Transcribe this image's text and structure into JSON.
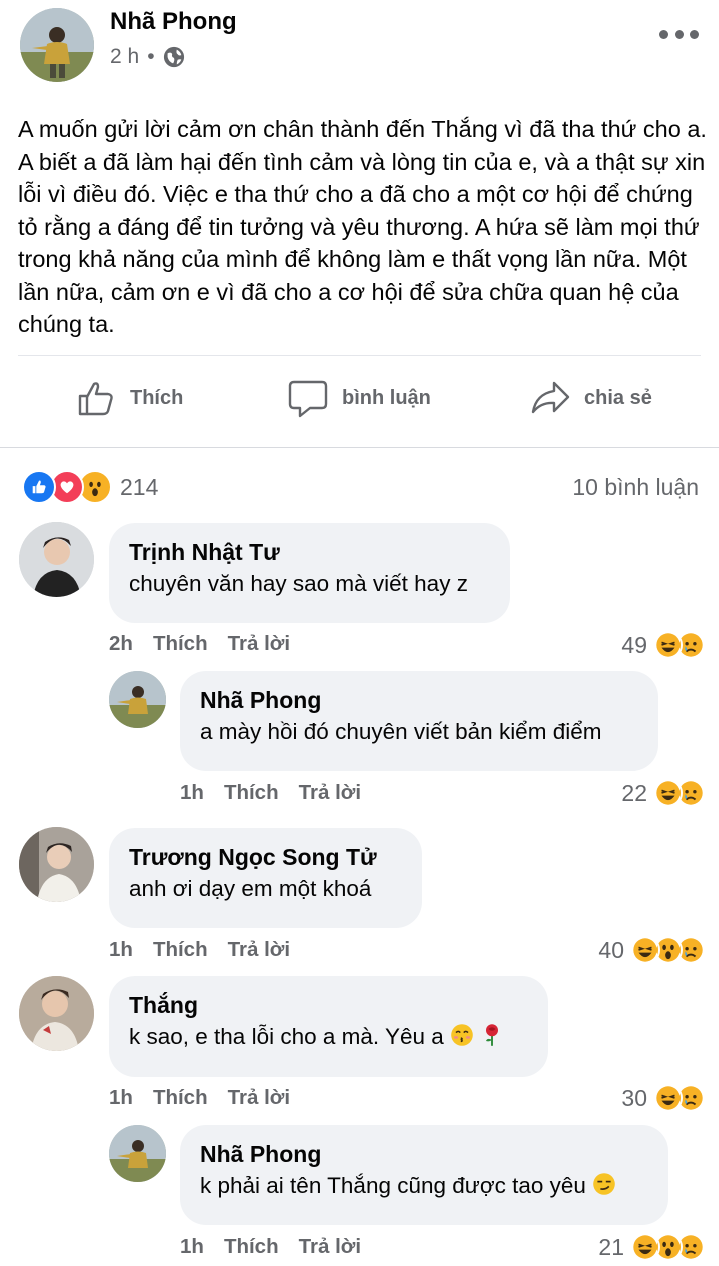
{
  "post": {
    "author": "Nhã Phong",
    "time": "2 h",
    "separator": "•",
    "text": "A muốn gửi lời cảm ơn chân thành đến Thắng vì đã tha thứ cho a. A biết a đã làm hại đến tình cảm và lòng tin của e, và a thật sự xin lỗi vì điều đó. Việc e tha thứ cho a đã cho a một cơ hội để chứng tỏ rằng a đáng để tin tưởng và yêu thương. A hứa sẽ làm mọi thứ trong khả năng của mình để không làm e thất vọng lần nữa. Một lần nữa, cảm ơn e vì đã cho a cơ hội để sửa chữa quan hệ của chúng ta."
  },
  "actions": {
    "like": "Thích",
    "comment": "bình luận",
    "share": "chia sẻ"
  },
  "summary": {
    "reactions": [
      "like",
      "love",
      "wow"
    ],
    "reaction_count": "214",
    "comment_count": "10 bình luận"
  },
  "comments": [
    {
      "name": "Trịnh Nhật Tư",
      "text": "chuyên văn hay sao mà viết hay z",
      "time": "2h",
      "like": "Thích",
      "reply": "Trả lời",
      "count": "49",
      "reactions": [
        "haha",
        "sad"
      ]
    },
    {
      "name": "Nhã Phong",
      "text": "a mày hồi đó chuyên viết bản kiểm điểm",
      "time": "1h",
      "like": "Thích",
      "reply": "Trả lời",
      "count": "22",
      "reactions": [
        "haha",
        "sad"
      ]
    },
    {
      "name": "Trương Ngọc Song Tử",
      "text": "anh ơi dạy em một khoá",
      "time": "1h",
      "like": "Thích",
      "reply": "Trả lời",
      "count": "40",
      "reactions": [
        "haha",
        "wow",
        "sad"
      ]
    },
    {
      "name": "Thắng",
      "text": "k sao, e tha lỗi cho a mà. Yêu a",
      "time": "1h",
      "like": "Thích",
      "reply": "Trả lời",
      "count": "30",
      "reactions": [
        "haha",
        "sad"
      ],
      "trailing_emoji": [
        "kissing-face",
        "rose"
      ]
    },
    {
      "name": "Nhã Phong",
      "text": "k phải ai tên Thắng cũng được tao yêu",
      "time": "1h",
      "like": "Thích",
      "reply": "Trả lời",
      "count": "21",
      "reactions": [
        "haha",
        "wow",
        "sad"
      ],
      "trailing_emoji": [
        "smirk-face"
      ]
    }
  ],
  "colors": {
    "like_blue": "#1877f2",
    "love_red": "#f33e58",
    "emoji_yellow": "#f7b125",
    "bubble_bg": "#f0f2f5",
    "meta_gray": "#65676b"
  }
}
